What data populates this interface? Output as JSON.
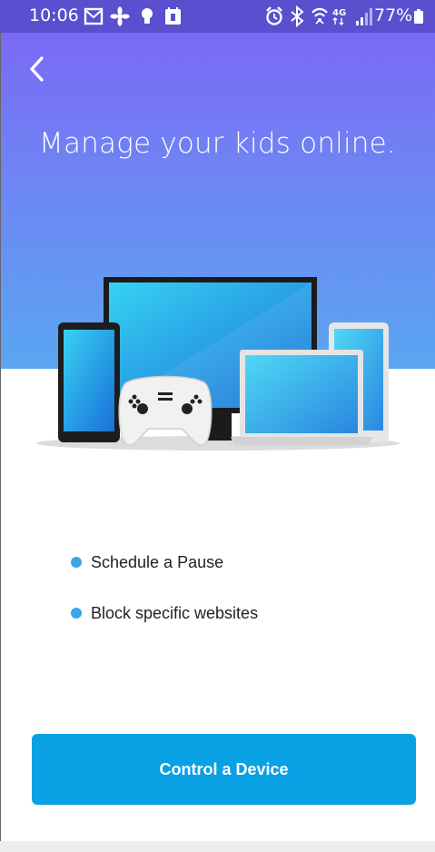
{
  "status_bar": {
    "time": "10:06",
    "battery_percent": "77%",
    "left_icons": [
      "mail-icon",
      "pinwheel-icon",
      "bulb-icon",
      "calendar-icon"
    ],
    "right_icons": [
      "alarm-icon",
      "bluetooth-icon",
      "wifi-calling-icon",
      "lte-icon",
      "signal-icon"
    ]
  },
  "header": {
    "title": "Manage your kids online."
  },
  "features": [
    {
      "label": "Schedule a Pause"
    },
    {
      "label": "Block specific websites"
    }
  ],
  "cta": {
    "label": "Control a Device"
  },
  "colors": {
    "accent": "#0aa1e4",
    "bullet": "#3aa5e9",
    "gradient_top": "#7a6af5",
    "gradient_bottom": "#5aa6f1"
  }
}
